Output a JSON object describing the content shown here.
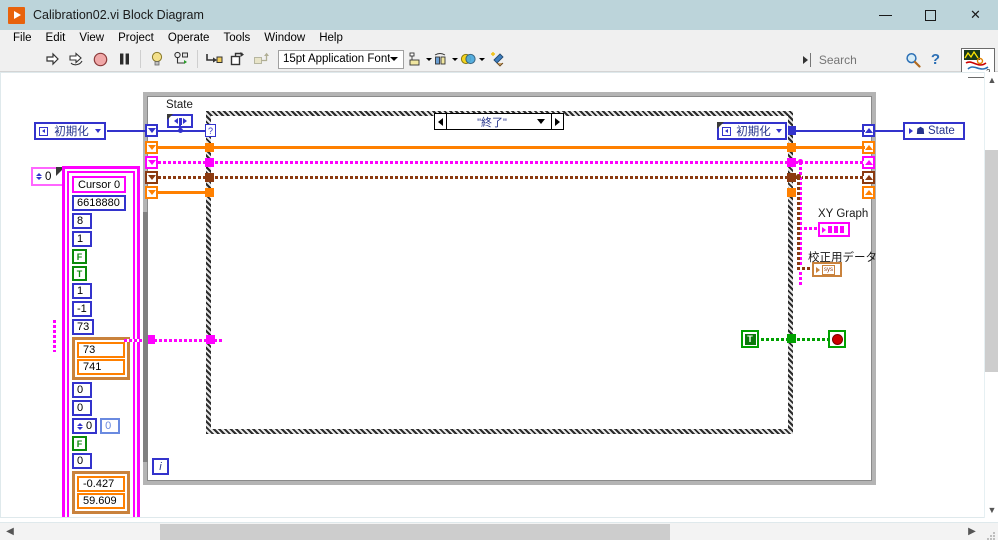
{
  "window": {
    "title": "Calibration02.vi Block Diagram",
    "app_icon": "labview-run-icon",
    "minimize": "minimize-icon",
    "maximize": "maximize-icon",
    "close": "close-icon"
  },
  "menu": {
    "items": [
      {
        "label": "File"
      },
      {
        "label": "Edit"
      },
      {
        "label": "View"
      },
      {
        "label": "Project"
      },
      {
        "label": "Operate"
      },
      {
        "label": "Tools"
      },
      {
        "label": "Window"
      },
      {
        "label": "Help"
      }
    ]
  },
  "toolbar": {
    "buttons": [
      {
        "name": "run-button",
        "icon": "run-arrow-icon"
      },
      {
        "name": "run-continuously-button",
        "icon": "run-continuously-icon"
      },
      {
        "name": "abort-execution-button",
        "icon": "abort-stop-icon"
      },
      {
        "name": "pause-button",
        "icon": "pause-icon"
      },
      {
        "name": "highlight-execution-button",
        "icon": "lightbulb-icon"
      },
      {
        "name": "retain-wire-values-button",
        "icon": "retain-wire-values-icon"
      },
      {
        "name": "step-into-button",
        "icon": "step-into-icon"
      },
      {
        "name": "step-over-button",
        "icon": "step-over-icon"
      },
      {
        "name": "step-out-button",
        "icon": "step-out-icon"
      }
    ],
    "font_selector": {
      "value": "15pt Application Font"
    },
    "align_objects": {
      "name": "align-objects-button",
      "icon": "align-objects-icon"
    },
    "distribute_objects": {
      "name": "distribute-objects-button",
      "icon": "distribute-objects-icon"
    },
    "resize_objects": {
      "name": "resize-objects-button",
      "icon": "resize-objects-icon"
    },
    "reorder": {
      "name": "reorder-button",
      "icon": "reorder-icon"
    },
    "clean_up_diagram": {
      "name": "clean-up-diagram-button",
      "icon": "clean-up-broom-icon"
    },
    "search": {
      "placeholder": "Search",
      "value": "",
      "icon": "magnifier-icon"
    },
    "help": {
      "icon": "question-mark-icon",
      "label": "?"
    },
    "vi_icon": {
      "name": "vi-icon-pane",
      "badge": "2"
    }
  },
  "diagram": {
    "labels": {
      "state_label": "State",
      "xy_graph": "XY Graph",
      "calibration_data": "校正用データ",
      "iteration": "i"
    },
    "case_selector": {
      "value": "\"終了\"",
      "left_arrow": "previous-case-arrow",
      "right_arrow": "next-case-arrow"
    },
    "enum_control": {
      "value": "初期化"
    },
    "enum_constant_inner": {
      "value": "初期化"
    },
    "state_indicator": {
      "value": "State"
    },
    "index_control": {
      "value": "0"
    },
    "cursor_cluster": {
      "name": "Cursor 0",
      "fields": [
        {
          "type": "string",
          "value": "Cursor 0"
        },
        {
          "type": "number",
          "value": "6618880"
        },
        {
          "type": "number",
          "value": "8"
        },
        {
          "type": "number",
          "value": "1"
        },
        {
          "type": "boolean",
          "value": "F"
        },
        {
          "type": "boolean",
          "value": "T"
        },
        {
          "type": "number",
          "value": "1"
        },
        {
          "type": "number",
          "value": "-1"
        },
        {
          "type": "number",
          "value": "73"
        }
      ],
      "subcluster_a": [
        {
          "value": "73"
        },
        {
          "value": "741"
        }
      ],
      "tail_fields": [
        {
          "type": "number",
          "value": "0"
        },
        {
          "type": "number",
          "value": "0"
        }
      ],
      "pair": {
        "left": "0",
        "right": "0"
      },
      "bool_tail": {
        "value": "F"
      },
      "num_tail": {
        "value": "0"
      },
      "subcluster_b": [
        {
          "value": "-0.427"
        },
        {
          "value": "59.609"
        }
      ]
    },
    "boolean_constant": {
      "value": "T"
    },
    "stop_control": {
      "name": "stop-button-terminal"
    }
  },
  "scrollbars": {
    "vertical": {
      "up": "scroll-up-arrow",
      "down": "scroll-down-arrow"
    },
    "horizontal": {
      "left": "scroll-left-arrow",
      "right": "scroll-right-arrow"
    }
  }
}
